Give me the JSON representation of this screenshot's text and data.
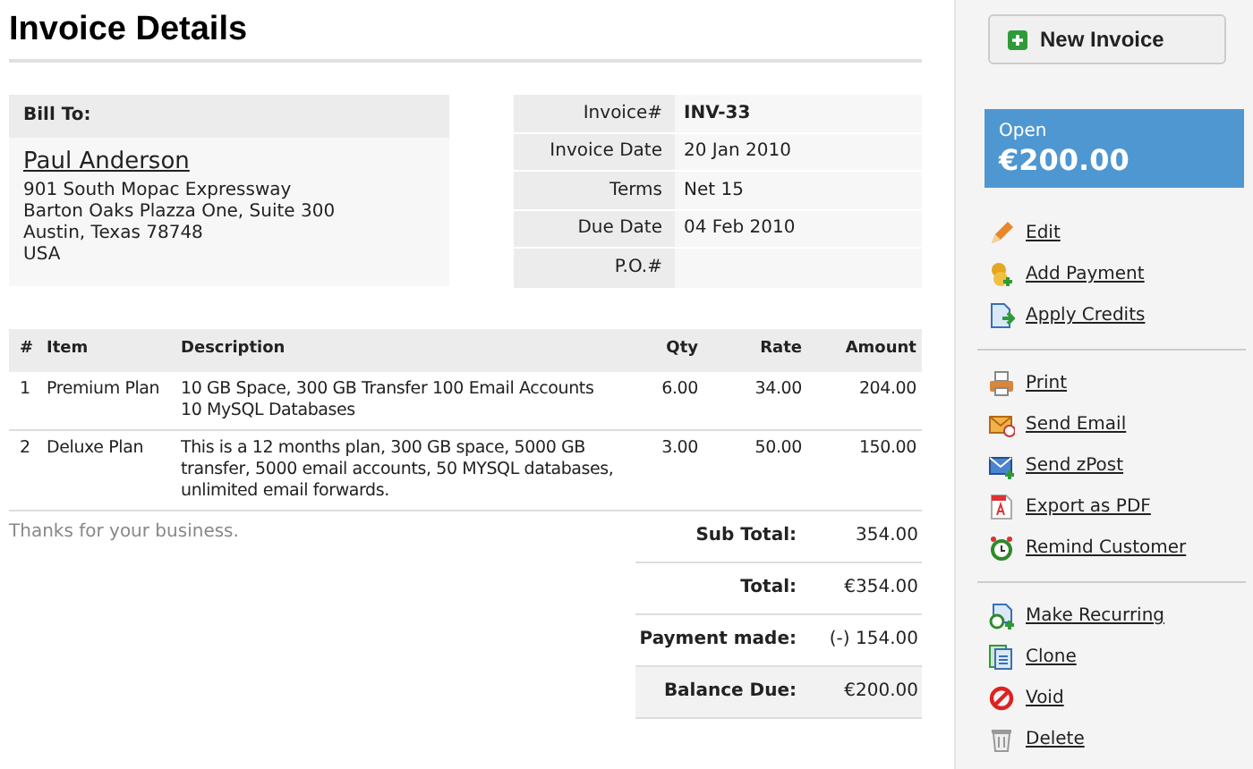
{
  "title": "Invoice Details",
  "bill_to": {
    "heading": "Bill To:",
    "name": "Paul Anderson",
    "address": [
      "901 South Mopac Expressway",
      "Barton Oaks Plazza One, Suite 300",
      "Austin, Texas 78748",
      "USA"
    ]
  },
  "invoice_info": [
    {
      "label": "Invoice#",
      "value": "INV-33",
      "bold": true
    },
    {
      "label": "Invoice Date",
      "value": "20 Jan 2010",
      "bold": false
    },
    {
      "label": "Terms",
      "value": "Net 15",
      "bold": false
    },
    {
      "label": "Due Date",
      "value": "04 Feb 2010",
      "bold": false
    },
    {
      "label": "P.O.#"
    }
  ],
  "table": {
    "columns": [
      "#",
      "Item",
      "Description",
      "Qty",
      "Rate",
      "Amount"
    ],
    "rows": [
      [
        "1",
        "Premium Plan",
        "10 GB Space, 300 GB Transfer 100 Email Accounts 10 MySQL Databases",
        "6.00",
        "34.00",
        "204.00"
      ],
      [
        "2",
        "Deluxe Plan",
        "This is a 12 months plan, 300 GB space, 5000 GB transfer, 5000 email accounts, 50 MYSQL databases, unlimited email forwards.",
        "3.00",
        "50.00",
        "150.00"
      ]
    ]
  },
  "notes": "Thanks for your business.",
  "totals": [
    {
      "label": "Sub Total:",
      "value": "354.00",
      "highlight": false
    },
    {
      "label": "Total:",
      "value": "€354.00",
      "highlight": false
    },
    {
      "label": "Payment made:",
      "value": "(-) 154.00",
      "highlight": false
    },
    {
      "label": "Balance Due:",
      "value": "€200.00",
      "highlight": true
    }
  ],
  "sidebar": {
    "new_button": "New Invoice",
    "status": {
      "label": "Open",
      "amount": "€200.00"
    },
    "action_groups": [
      [
        {
          "kind": "edit",
          "label": "Edit"
        },
        {
          "kind": "payment",
          "label": "Add Payment"
        },
        {
          "kind": "credits",
          "label": "Apply Credits"
        }
      ],
      [
        {
          "kind": "print",
          "label": "Print"
        },
        {
          "kind": "email",
          "label": "Send Email"
        },
        {
          "kind": "post",
          "label": "Send zPost"
        },
        {
          "kind": "pdf",
          "label": "Export as PDF"
        },
        {
          "kind": "remind",
          "label": "Remind Customer"
        }
      ],
      [
        {
          "kind": "recurring",
          "label": "Make Recurring"
        },
        {
          "kind": "clone",
          "label": "Clone"
        },
        {
          "kind": "void",
          "label": "Void"
        },
        {
          "kind": "delete",
          "label": "Delete"
        }
      ]
    ]
  }
}
